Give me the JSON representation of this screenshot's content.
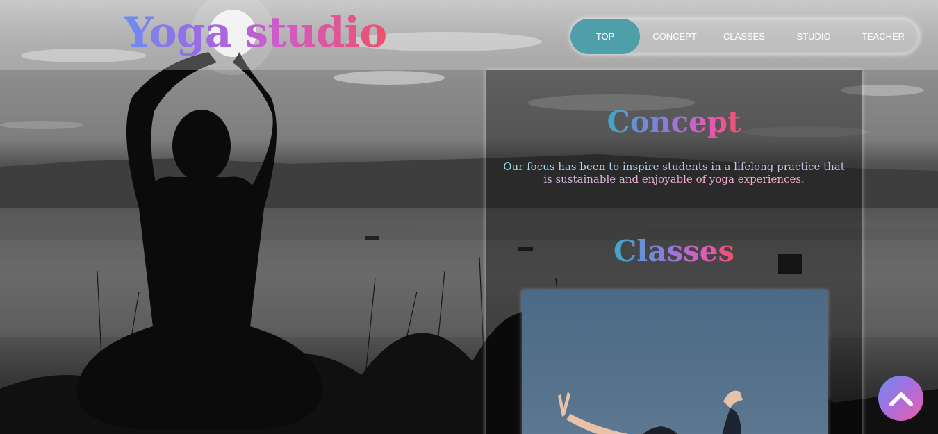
{
  "brand": {
    "logo_text": "Yoga studio"
  },
  "nav": {
    "items": [
      {
        "label": "TOP",
        "active": true
      },
      {
        "label": "CONCEPT",
        "active": false
      },
      {
        "label": "CLASSES",
        "active": false
      },
      {
        "label": "STUDIO",
        "active": false
      },
      {
        "label": "TEACHER",
        "active": false
      }
    ],
    "active_color": "#4f9faa"
  },
  "concept": {
    "heading": "Concept",
    "text": "Our focus has been to inspire students in a lifelong practice that is sustainable and enjoyable of yoga experiences."
  },
  "classes": {
    "heading": "Classes"
  },
  "scroll_top": {
    "icon": "chevron-up-icon"
  },
  "colors": {
    "gradient_start": "#6e8cf0",
    "gradient_mid": "#d05bc8",
    "gradient_end": "#f0506a"
  }
}
